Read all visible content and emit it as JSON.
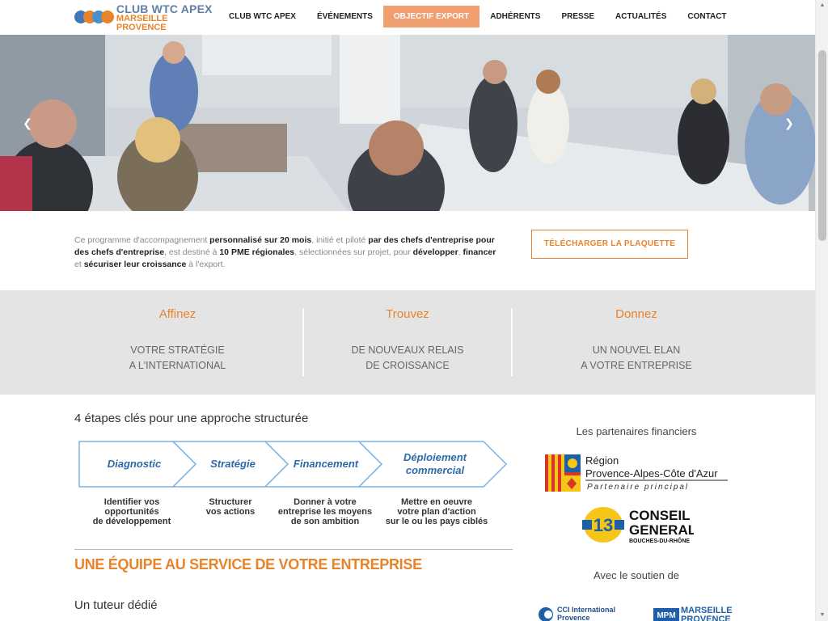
{
  "logo": {
    "line1": "CLUB WTC APEX",
    "line2": "MARSEILLE PROVENCE"
  },
  "menu": [
    {
      "label": "CLUB WTC APEX",
      "active": false
    },
    {
      "label": "ÉVÉNEMENTS",
      "active": false
    },
    {
      "label": "OBJECTIF EXPORT",
      "active": true
    },
    {
      "label": "ADHÉRENTS",
      "active": false
    },
    {
      "label": "PRESSE",
      "active": false
    },
    {
      "label": "ACTUALITÉS",
      "active": false
    },
    {
      "label": "CONTACT",
      "active": false
    }
  ],
  "hero": {
    "prev_icon": "chevron-left-icon",
    "next_icon": "chevron-right-icon"
  },
  "intro": {
    "t1": "Ce programme d'accompagnement ",
    "b1": "personnalisé sur 20 mois",
    "t2": ", initié et piloté ",
    "b2": "par des chefs d'entreprise pour des chefs d'entreprise",
    "t3": ", est destiné à ",
    "b3": "10 PME régionales",
    "t4": ", sélectionnées sur projet, pour ",
    "b4": "développer",
    "t5": ", ",
    "b5": "financer",
    "t6": " et ",
    "b6": "sécuriser leur croissance",
    "t7": " à l'export."
  },
  "download_label": "TÉLÉCHARGER LA PLAQUETTE",
  "band": [
    {
      "head": "Affinez",
      "line1": "VOTRE STRATÉGIE",
      "line2": "A L'INTERNATIONAL"
    },
    {
      "head": "Trouvez",
      "line1": "DE NOUVEAUX RELAIS",
      "line2": "DE CROISSANCE"
    },
    {
      "head": "Donnez",
      "line1": "UN NOUVEL ELAN",
      "line2": "A VOTRE ENTREPRISE"
    }
  ],
  "steps_title": "4 étapes clés pour une approche structurée",
  "steps": [
    {
      "name": "Diagnostic",
      "name2": "",
      "cap1": "Identifier vos",
      "cap2": "opportunités",
      "cap3": "de développement"
    },
    {
      "name": "Stratégie",
      "name2": "",
      "cap1": "Structurer",
      "cap2": "vos actions",
      "cap3": ""
    },
    {
      "name": "Financement",
      "name2": "",
      "cap1": "Donner à votre",
      "cap2": "entreprise les moyens",
      "cap3": "de son ambition"
    },
    {
      "name": "Déploiement",
      "name2": "commercial",
      "cap1": "Mettre en oeuvre",
      "cap2": "votre plan d'action",
      "cap3": "sur le ou les pays ciblés"
    }
  ],
  "team_title": "UNE ÉQUIPE AU SERVICE DE VOTRE ENTREPRISE",
  "tutor_title": "Un tuteur dédié",
  "partners": {
    "head": "Les partenaires financiers",
    "region_l1": "Région",
    "region_l2": "Provence-Alpes-Côte d'Azur",
    "region_l3": "Partenaire principal",
    "cg_l1": "CONSEIL",
    "cg_l2": "GENERAL",
    "cg_l3": "BOUCHES-DU-RHÔNE",
    "cg_num": "13",
    "support_head": "Avec le soutien de",
    "cci_l1": "CCI International",
    "cci_l2": "Provence",
    "mpm_badge": "MPM",
    "mpm_l1": "MARSEILLE",
    "mpm_l2": "PROVENCE"
  },
  "colors": {
    "accent": "#e9832a",
    "active_menu": "#f0a070",
    "band_bg": "#e4e4e4",
    "steps_blue": "#2e6aa8"
  }
}
